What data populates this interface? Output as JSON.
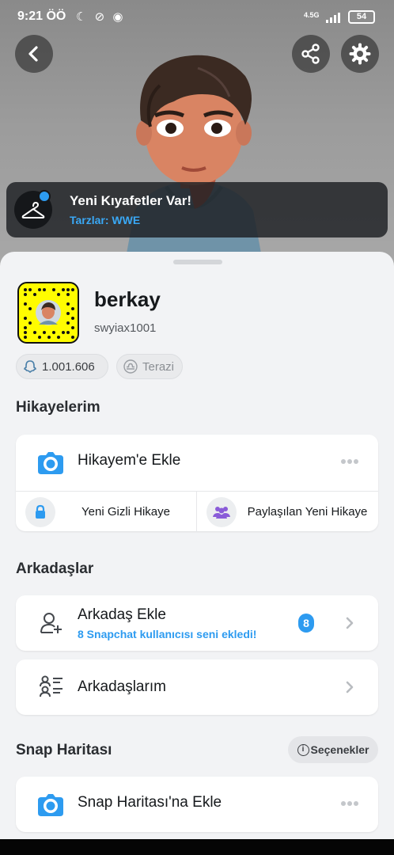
{
  "status_bar": {
    "time": "9:21 ÖÖ",
    "left_icons": "☾ ⊘ ◉",
    "network": "4.5G",
    "battery": "54"
  },
  "header": {
    "back_icon": "chevron-left-icon",
    "share_icon": "share-icon",
    "settings_icon": "gear-icon"
  },
  "notice": {
    "title": "Yeni Kıyafetler Var!",
    "subtitle": "Tarzlar: WWE",
    "icon": "hanger-icon"
  },
  "profile": {
    "display_name": "berkay",
    "username": "swyiax1001",
    "snap_score": "1.001.606",
    "zodiac": "Terazi"
  },
  "stories": {
    "section_title": "Hikayelerim",
    "add_story": "Hikayem'e Ekle",
    "private_story": "Yeni Gizli Hikaye",
    "shared_story": "Paylaşılan Yeni Hikaye"
  },
  "friends": {
    "section_title": "Arkadaşlar",
    "add_friend": "Arkadaş Ekle",
    "add_friend_sub": "8 Snapchat kullanıcısı seni ekledi!",
    "add_friend_badge": "8",
    "my_friends": "Arkadaşlarım"
  },
  "snap_map": {
    "section_title": "Snap Haritası",
    "options": "Seçenekler",
    "add_to_map": "Snap Haritası'na Ekle"
  },
  "colors": {
    "accent_blue": "#2d9bf0",
    "snap_yellow": "#fffc00",
    "purple": "#8a5cd8"
  }
}
